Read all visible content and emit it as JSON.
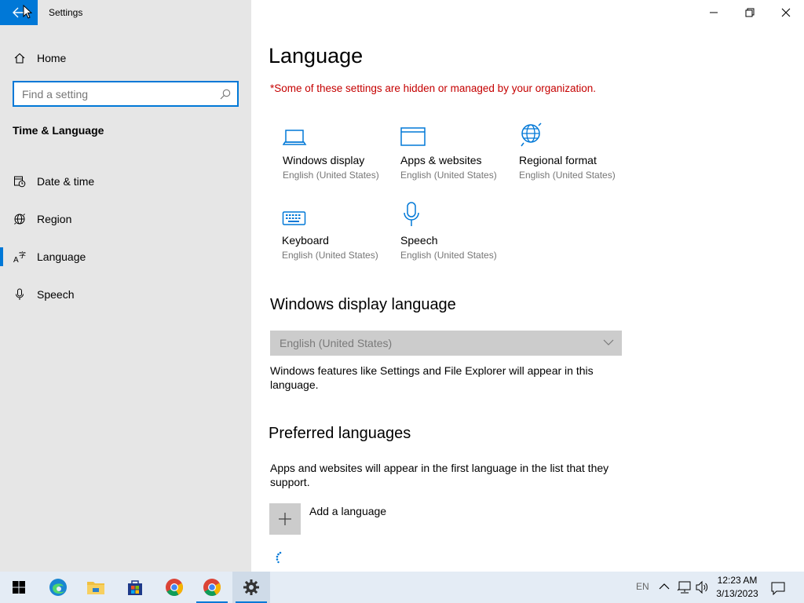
{
  "window": {
    "app_title": "Settings",
    "minimize_icon": "minimize-icon",
    "maximize_icon": "restore-icon",
    "close_icon": "close-icon"
  },
  "sidebar": {
    "home_label": "Home",
    "search": {
      "placeholder": "Find a setting",
      "value": ""
    },
    "section_title": "Time & Language",
    "items": [
      {
        "label": "Date & time",
        "icon": "date-time-icon",
        "active": false
      },
      {
        "label": "Region",
        "icon": "globe-icon",
        "active": false
      },
      {
        "label": "Language",
        "icon": "language-icon",
        "active": true
      },
      {
        "label": "Speech",
        "icon": "microphone-icon",
        "active": false
      }
    ]
  },
  "main": {
    "title": "Language",
    "org_notice": "*Some of these settings are hidden or managed by your organization.",
    "tiles": [
      {
        "name": "Windows display",
        "sub": "English (United States)",
        "icon": "laptop-icon"
      },
      {
        "name": "Apps & websites",
        "sub": "English (United States)",
        "icon": "browser-window-icon"
      },
      {
        "name": "Regional format",
        "sub": "English (United States)",
        "icon": "regional-globe-icon"
      },
      {
        "name": "Keyboard",
        "sub": "English (United States)",
        "icon": "keyboard-icon"
      },
      {
        "name": "Speech",
        "sub": "English (United States)",
        "icon": "microphone-icon"
      }
    ],
    "display_language": {
      "heading": "Windows display language",
      "selected": "English (United States)",
      "description": "Windows features like Settings and File Explorer will appear in this language."
    },
    "preferred": {
      "heading": "Preferred languages",
      "description": "Apps and websites will appear in the first language in the list that they support.",
      "add_label": "Add a language"
    }
  },
  "taskbar": {
    "apps": [
      "start-icon",
      "edge-icon",
      "file-explorer-icon",
      "store-icon",
      "chrome-icon",
      "chrome-icon",
      "settings-icon"
    ],
    "input_indicator": "EN",
    "time": "12:23 AM",
    "date": "3/13/2023"
  },
  "colors": {
    "accent": "#0078d7",
    "warning": "#c50000",
    "sidebar_bg": "#e6e6e6",
    "taskbar_bg": "#e4ecf5"
  }
}
